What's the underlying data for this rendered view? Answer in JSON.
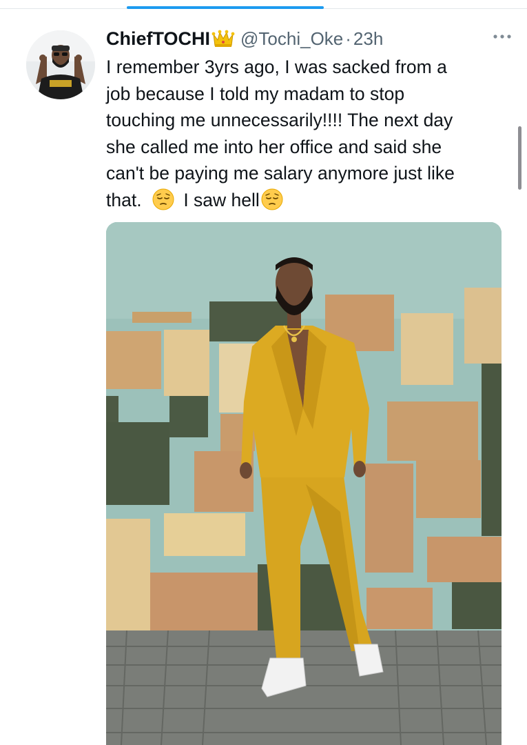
{
  "tweet": {
    "display_name": "ChiefTOCHI",
    "handle": "@Tochi_Oke",
    "separator": "·",
    "time": "23h",
    "text_lines": [
      "I remember 3yrs ago, I was sacked from a",
      "job because I told my madam to stop",
      "touching me unnecessarily!!!! The next day",
      "she called me into her office and said she",
      "can't be paying me salary anymore just like"
    ],
    "last_line_part1": "that.",
    "last_line_part2": "I saw hell",
    "badge_icon": "crown-icon",
    "emoji_name": "pensive-face-emoji",
    "more_icon": "more-options-icon"
  },
  "colors": {
    "accent": "#1d9bf0",
    "text": "#0f1419",
    "secondary_text": "#536471",
    "outfit": "#d8a621"
  }
}
